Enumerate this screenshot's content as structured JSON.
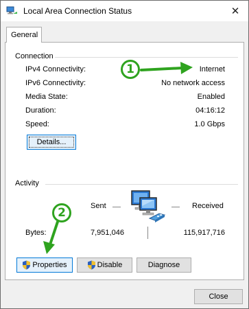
{
  "window": {
    "title": "Local Area Connection Status",
    "close_glyph": "✕"
  },
  "tabs": [
    {
      "label": "General",
      "selected": true
    }
  ],
  "connection": {
    "heading": "Connection",
    "rows": [
      {
        "label": "IPv4 Connectivity:",
        "value": "Internet"
      },
      {
        "label": "IPv6 Connectivity:",
        "value": "No network access"
      },
      {
        "label": "Media State:",
        "value": "Enabled"
      },
      {
        "label": "Duration:",
        "value": "04:16:12"
      },
      {
        "label": "Speed:",
        "value": "1.0 Gbps"
      }
    ],
    "details_button": "Details..."
  },
  "activity": {
    "heading": "Activity",
    "sent_label": "Sent",
    "received_label": "Received",
    "bytes_label": "Bytes:",
    "bytes_sent": "7,951,046",
    "bytes_received": "115,917,716"
  },
  "actions": {
    "properties": "Properties",
    "disable": "Disable",
    "diagnose": "Diagnose"
  },
  "footer": {
    "close": "Close"
  },
  "annotations": [
    {
      "number": "1"
    },
    {
      "number": "2"
    }
  ],
  "colors": {
    "annotation": "#2fa31f",
    "focus_blue": "#0078d7",
    "button_face": "#e1e1e1"
  }
}
